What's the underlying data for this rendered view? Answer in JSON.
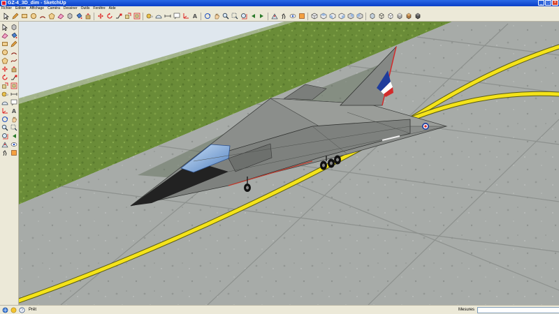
{
  "window": {
    "title": "GZ-4_3D_dim - SketchUp"
  },
  "menu": [
    "Fichier",
    "Edition",
    "Affichage",
    "Caméra",
    "Dessiner",
    "Outils",
    "Fenêtre",
    "Aide"
  ],
  "toolbar_icons": [
    "select-arrow-icon",
    "pencil-icon",
    "rectangle-icon",
    "circle-icon",
    "arc-icon",
    "polygon-icon",
    "eraser-icon",
    "make-component-icon",
    "paint-bucket-icon",
    "push-pull-icon",
    "sep",
    "move-icon",
    "rotate-icon",
    "follow-me-icon",
    "scale-icon",
    "offset-icon",
    "sep",
    "tape-measure-icon",
    "protractor-icon",
    "dimension-icon",
    "text-icon",
    "axes-icon",
    "3d-text-icon",
    "sep",
    "orbit-icon",
    "pan-icon",
    "zoom-icon",
    "zoom-window-icon",
    "zoom-extents-icon",
    "previous-view-icon",
    "next-view-icon",
    "sep",
    "position-camera-icon",
    "walk-icon",
    "look-around-icon",
    "section-plane-icon",
    "sep",
    "iso-view-icon",
    "top-view-icon",
    "front-view-icon",
    "right-view-icon",
    "back-view-icon",
    "left-view-icon",
    "sep",
    "xray-icon",
    "wireframe-icon",
    "hidden-line-icon",
    "shaded-icon",
    "shaded-textures-icon",
    "monochrome-icon"
  ],
  "left_tools": [
    "select-arrow-icon",
    "make-component-icon",
    "eraser-icon",
    "paint-bucket-icon",
    "rectangle-icon",
    "pencil-icon",
    "circle-icon",
    "arc-icon",
    "polygon-icon",
    "freehand-icon",
    "move-icon",
    "push-pull-icon",
    "rotate-icon",
    "follow-me-icon",
    "scale-icon",
    "offset-icon",
    "tape-measure-icon",
    "dimension-icon",
    "protractor-icon",
    "text-icon",
    "axes-icon",
    "3d-text-icon",
    "orbit-icon",
    "pan-icon",
    "zoom-icon",
    "zoom-window-icon",
    "zoom-extents-icon",
    "previous-view-icon",
    "position-camera-icon",
    "look-around-icon",
    "walk-icon",
    "section-plane-icon"
  ],
  "status": {
    "text": "Prêt",
    "measures_label": "Mesures",
    "measures_value": ""
  },
  "scene": {
    "colors": {
      "grass": "#6b8e3a",
      "concrete": "#a9adaa",
      "line": "#f5e61e",
      "jet": "#8c8f8c",
      "canopy": "#6f9fd8",
      "sky": "#dfe7ee"
    },
    "aircraft_roundel_colors": [
      "#1f3c9c",
      "#ffffff",
      "#d32b2b"
    ]
  }
}
